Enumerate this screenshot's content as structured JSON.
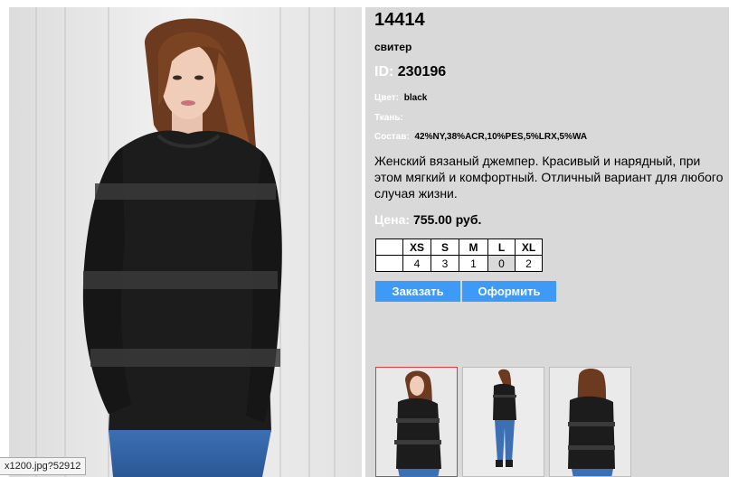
{
  "product": {
    "article": "14414",
    "type": "свитер",
    "id_label": "ID:",
    "id_value": "230196",
    "color_label": "Цвет:",
    "color_value": "black",
    "fabric_label": "Ткань:",
    "fabric_value": "",
    "composition_label": "Состав:",
    "composition_value": "42%NY,38%ACR,10%PES,5%LRX,5%WA",
    "description": "Женский вязаный джемпер. Красивый и нарядный, при этом мягкий и комфортный. Отличный вариант для любого случая жизни.",
    "price_label": "Цена:",
    "price_value": "755.00 руб."
  },
  "sizes": {
    "headers": [
      "XS",
      "S",
      "M",
      "L",
      "XL"
    ],
    "stock": [
      "4",
      "3",
      "1",
      "0",
      "2"
    ]
  },
  "buttons": {
    "order": "Заказать",
    "checkout": "Оформить"
  },
  "thumbnails": [
    {
      "pose": "front-close",
      "active": true
    },
    {
      "pose": "front-full",
      "active": false
    },
    {
      "pose": "back",
      "active": false
    }
  ],
  "status_bar": {
    "text": "x1200.jpg?52912"
  },
  "colors": {
    "panel_bg": "#d9d9d9",
    "button_bg": "#3d9bf7",
    "active_thumb_border": "#e0383b",
    "label_white": "#ffffff"
  }
}
